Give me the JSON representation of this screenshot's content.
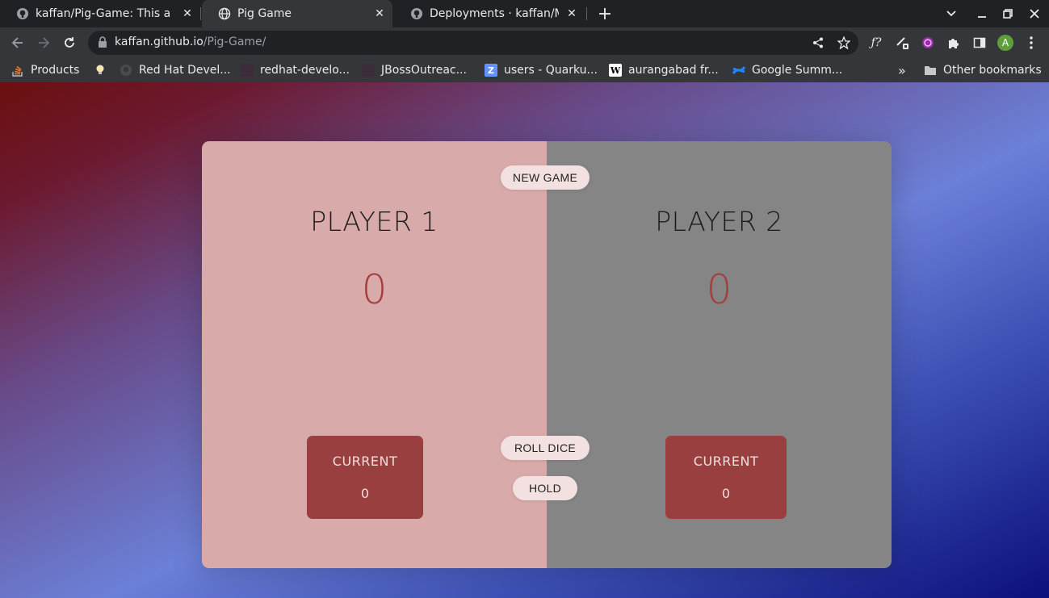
{
  "browser": {
    "tabs": [
      {
        "title": "kaffan/Pig-Game: This a fun game",
        "icon": "github-icon",
        "active": false
      },
      {
        "title": "Pig Game",
        "icon": "globe-icon",
        "active": true
      },
      {
        "title": "Deployments · kaffan/Ma",
        "icon": "github-icon",
        "active": false
      }
    ],
    "new_tab_label": "+",
    "url_host": "kaffan.github.io",
    "url_path": "/Pig-Game/",
    "profile_initial": "A",
    "bookmarks": [
      {
        "label": "Products",
        "icon": "stack-overflow-icon"
      },
      {
        "label": "",
        "icon": "lightbulb-icon"
      },
      {
        "label": "Red Hat Devel...",
        "icon": "github-icon"
      },
      {
        "label": "redhat-develo...",
        "icon": "square-icon"
      },
      {
        "label": "JBossOutreac...",
        "icon": "square-icon"
      },
      {
        "label": "users - Quarku...",
        "icon": "zulip-icon"
      },
      {
        "label": "aurangabad fr...",
        "icon": "wikipedia-icon"
      },
      {
        "label": "Google Summ...",
        "icon": "confluence-icon"
      }
    ],
    "bookmarks_overflow": "»",
    "other_bookmarks": "Other bookmarks",
    "colors": {
      "frame": "#202124",
      "toolbar": "#35363a",
      "text": "#e8eaed",
      "avatar": "#5e9f3b"
    }
  },
  "game": {
    "player1": {
      "name": "Player 1",
      "score": "0",
      "current_label": "Current",
      "current_score": "0",
      "bg": "#d9aaaa"
    },
    "player2": {
      "name": "Player 2",
      "score": "0",
      "current_label": "Current",
      "current_score": "0",
      "bg": "#858585"
    },
    "buttons": {
      "new_game": "New game",
      "roll_dice": "Roll dice",
      "hold": "Hold"
    },
    "colors": {
      "score": "#a53d3d",
      "current_box": "#993f3f",
      "button": "#f3e1e1"
    }
  }
}
